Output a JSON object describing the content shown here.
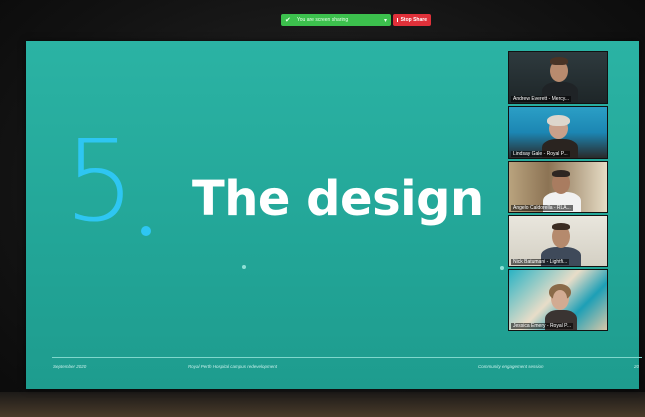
{
  "share_toolbar": {
    "sharing_text": "You are screen sharing",
    "stop_label": "Stop Share"
  },
  "slide": {
    "section_number": "5",
    "title": "The design",
    "footer": {
      "date": "September 2020",
      "project": "Royal Perth Hospital campus redevelopment",
      "report": "Community engagement session",
      "page": "20"
    },
    "colors": {
      "background": "#22a597",
      "number": "#2ec6f2",
      "title": "#ffffff"
    }
  },
  "participants": [
    {
      "name": "Andrew Everett - Mercy...",
      "icon": "video-tile"
    },
    {
      "name": "Lindsay Gale - Royal P...",
      "icon": "video-tile"
    },
    {
      "name": "Angelo Caldorella - RLA...",
      "icon": "video-tile"
    },
    {
      "name": "Nick Batumani - Lightfi...",
      "icon": "video-tile"
    },
    {
      "name": "Jessica Emery - Royal P...",
      "icon": "video-tile"
    }
  ]
}
